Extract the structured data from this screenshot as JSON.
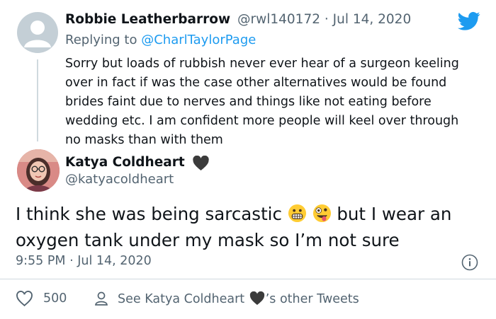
{
  "reply_tweet": {
    "author_name": "Robbie Leatherbarrow",
    "handle_date": "@rwl140172 · Jul 14, 2020",
    "replying_prefix": "Replying to",
    "replying_to": "@CharlTaylorPage",
    "text": "Sorry but loads of rubbish never ever hear of a surgeon keeling over in fact if was the case other alternatives would be found brides faint due to nerves and things like not eating before wedding etc. I am confident more people will keel over through no masks than with them"
  },
  "main_tweet": {
    "author_name": "Katya Coldheart",
    "handle": "@katyacoldheart",
    "text_part1": "I think she was being sarcastic ",
    "text_part2": " but I wear an oxygen tank under my mask so I’m not sure",
    "emojis": [
      "grimacing-face",
      "zany-face"
    ],
    "timestamp": "9:55 PM · Jul 14, 2020",
    "like_count": "500",
    "see_other_prefix": "See Katya Coldheart",
    "see_other_suffix": "’s other Tweets"
  },
  "icons": {
    "brand": "twitter-bird-icon",
    "like": "heart-outline-icon",
    "profile": "person-icon",
    "info": "info-icon"
  },
  "colors": {
    "brand_blue": "#1d9bf0",
    "secondary_text": "#536471",
    "primary_text": "#0f1419",
    "divider": "#cfd9de",
    "heart_emoji": "#3b3b3b"
  }
}
